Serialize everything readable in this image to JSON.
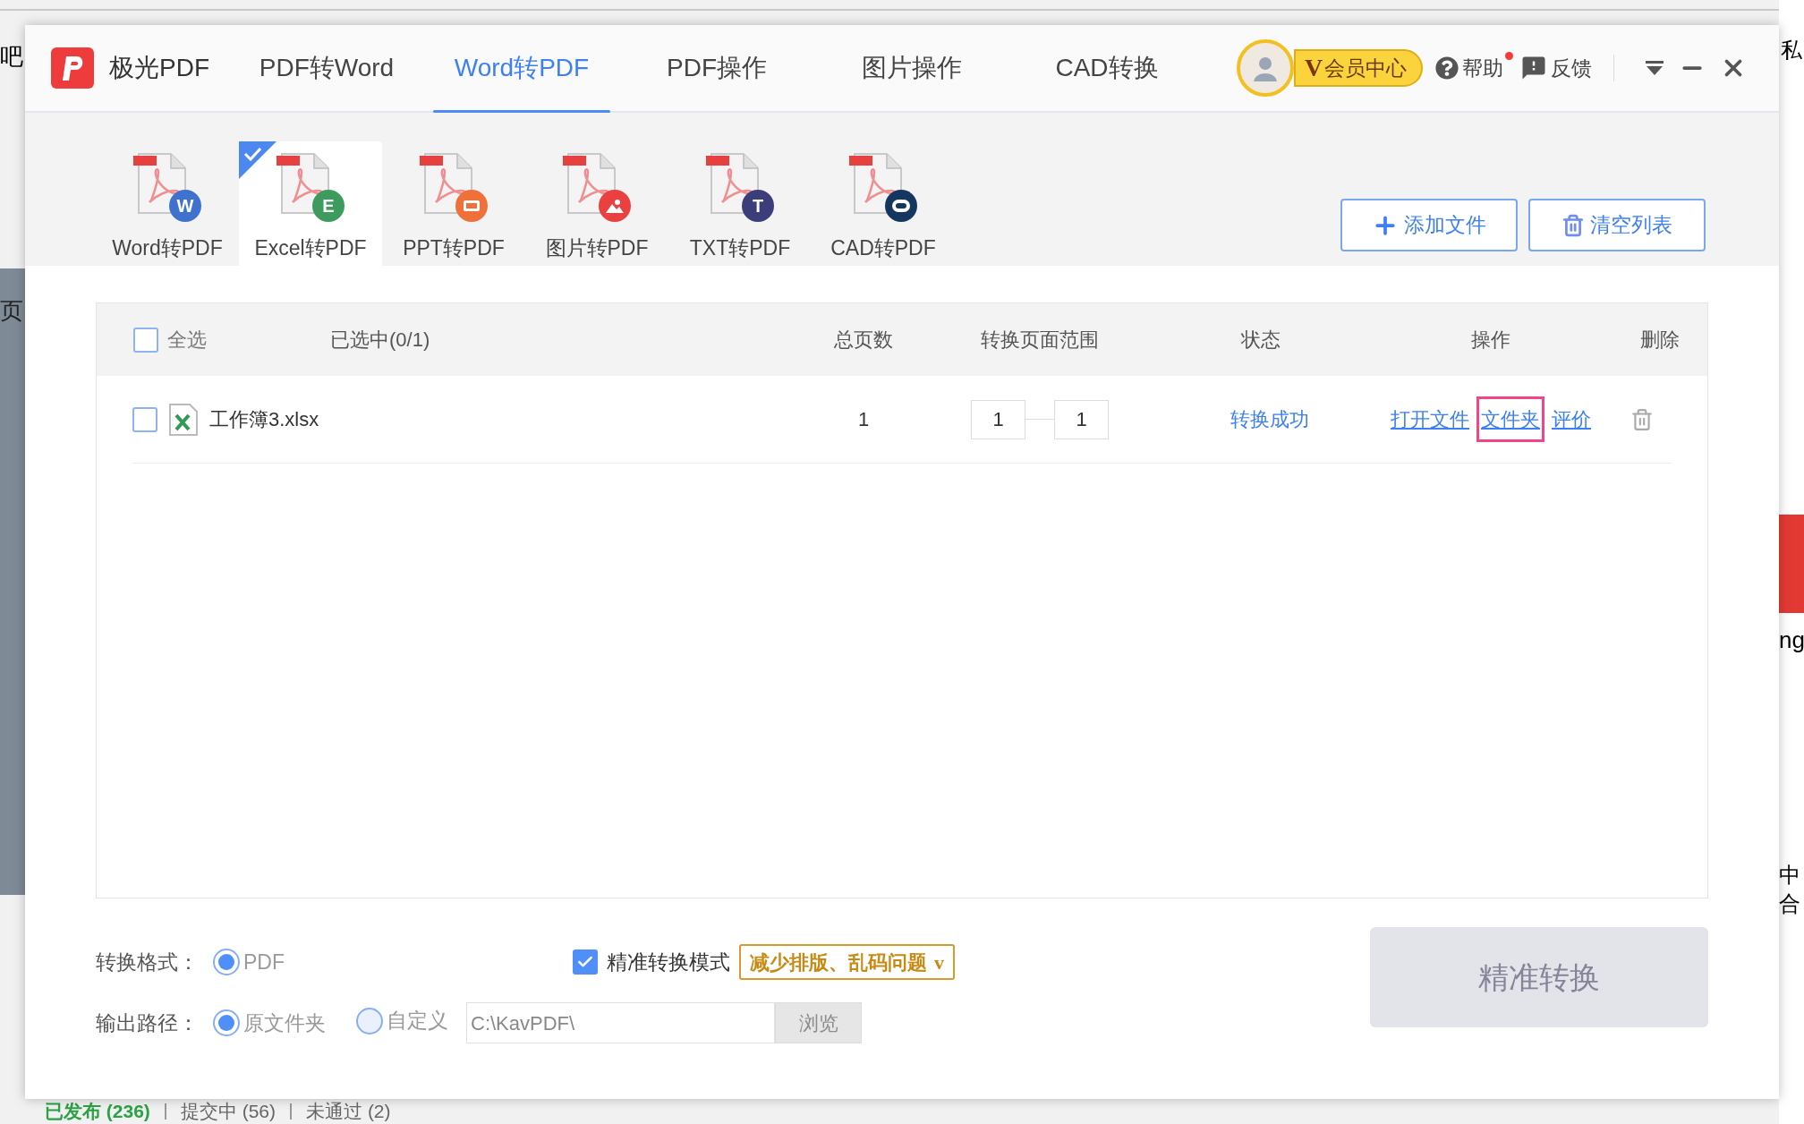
{
  "background": {
    "top_left_text": "吧",
    "left_text": "页",
    "right_texts": [
      "私",
      "ng",
      "中",
      "合"
    ],
    "bottom_tabs": [
      {
        "label": "已发布 (236)",
        "selected": true
      },
      {
        "label": "提交中 (56)",
        "selected": false
      },
      {
        "label": "未通过 (2)",
        "selected": false
      }
    ]
  },
  "app": {
    "logo_text": "极光PDF",
    "nav": [
      {
        "label": "PDF转Word",
        "selected": false
      },
      {
        "label": "Word转PDF",
        "selected": true
      },
      {
        "label": "PDF操作",
        "selected": false
      },
      {
        "label": "图片操作",
        "selected": false
      },
      {
        "label": "CAD转换",
        "selected": false
      }
    ],
    "vip": {
      "mark": "V",
      "label": "会员中心"
    },
    "help": {
      "label": "帮助",
      "notification": true
    },
    "feedback": "反馈",
    "tools": [
      {
        "label": "Word转PDF",
        "selected": false,
        "color": "#3f72cf",
        "kind": "letter",
        "badge_text": "W"
      },
      {
        "label": "Excel转PDF",
        "selected": true,
        "color": "#3d9b5e",
        "kind": "letter",
        "badge_text": "E"
      },
      {
        "label": "PPT转PDF",
        "selected": false,
        "color": "#f0703a",
        "kind": "slides"
      },
      {
        "label": "图片转PDF",
        "selected": false,
        "color": "#ea4040",
        "kind": "image"
      },
      {
        "label": "TXT转PDF",
        "selected": false,
        "color": "#3b3e7a",
        "kind": "letter",
        "badge_text": "T"
      },
      {
        "label": "CAD转PDF",
        "selected": false,
        "color": "#15365e",
        "kind": "cad"
      }
    ],
    "add_button": "添加文件",
    "clear_button": "清空列表",
    "table": {
      "select_all": {
        "label": "全选",
        "checked": false
      },
      "selected_count": "已选中(0/1)",
      "columns": [
        "总页数",
        "转换页面范围",
        "状态",
        "操作",
        "删除"
      ],
      "rows": [
        {
          "checked": false,
          "file": "工作簿3.xlsx",
          "pages": "1",
          "range_from": "1",
          "range_to": "1",
          "status": "转换成功",
          "actions": [
            {
              "label": "打开文件",
              "highlighted": false
            },
            {
              "label": "文件夹",
              "highlighted": true
            },
            {
              "label": "评价",
              "highlighted": false
            }
          ]
        }
      ]
    },
    "format": {
      "label": "转换格式：",
      "options": [
        {
          "label": "PDF",
          "selected": true
        }
      ]
    },
    "precise": {
      "label": "精准转换模式",
      "checked": true,
      "dropdown": "减少排版、乱码问题",
      "dropdown_mark": "v"
    },
    "output": {
      "label": "输出路径：",
      "options": [
        {
          "label": "原文件夹",
          "selected": true
        },
        {
          "label": "自定义",
          "selected": false
        }
      ],
      "path": "C:\\KavPDF\\",
      "browse": "浏览"
    },
    "convert_button": "精准转换"
  }
}
